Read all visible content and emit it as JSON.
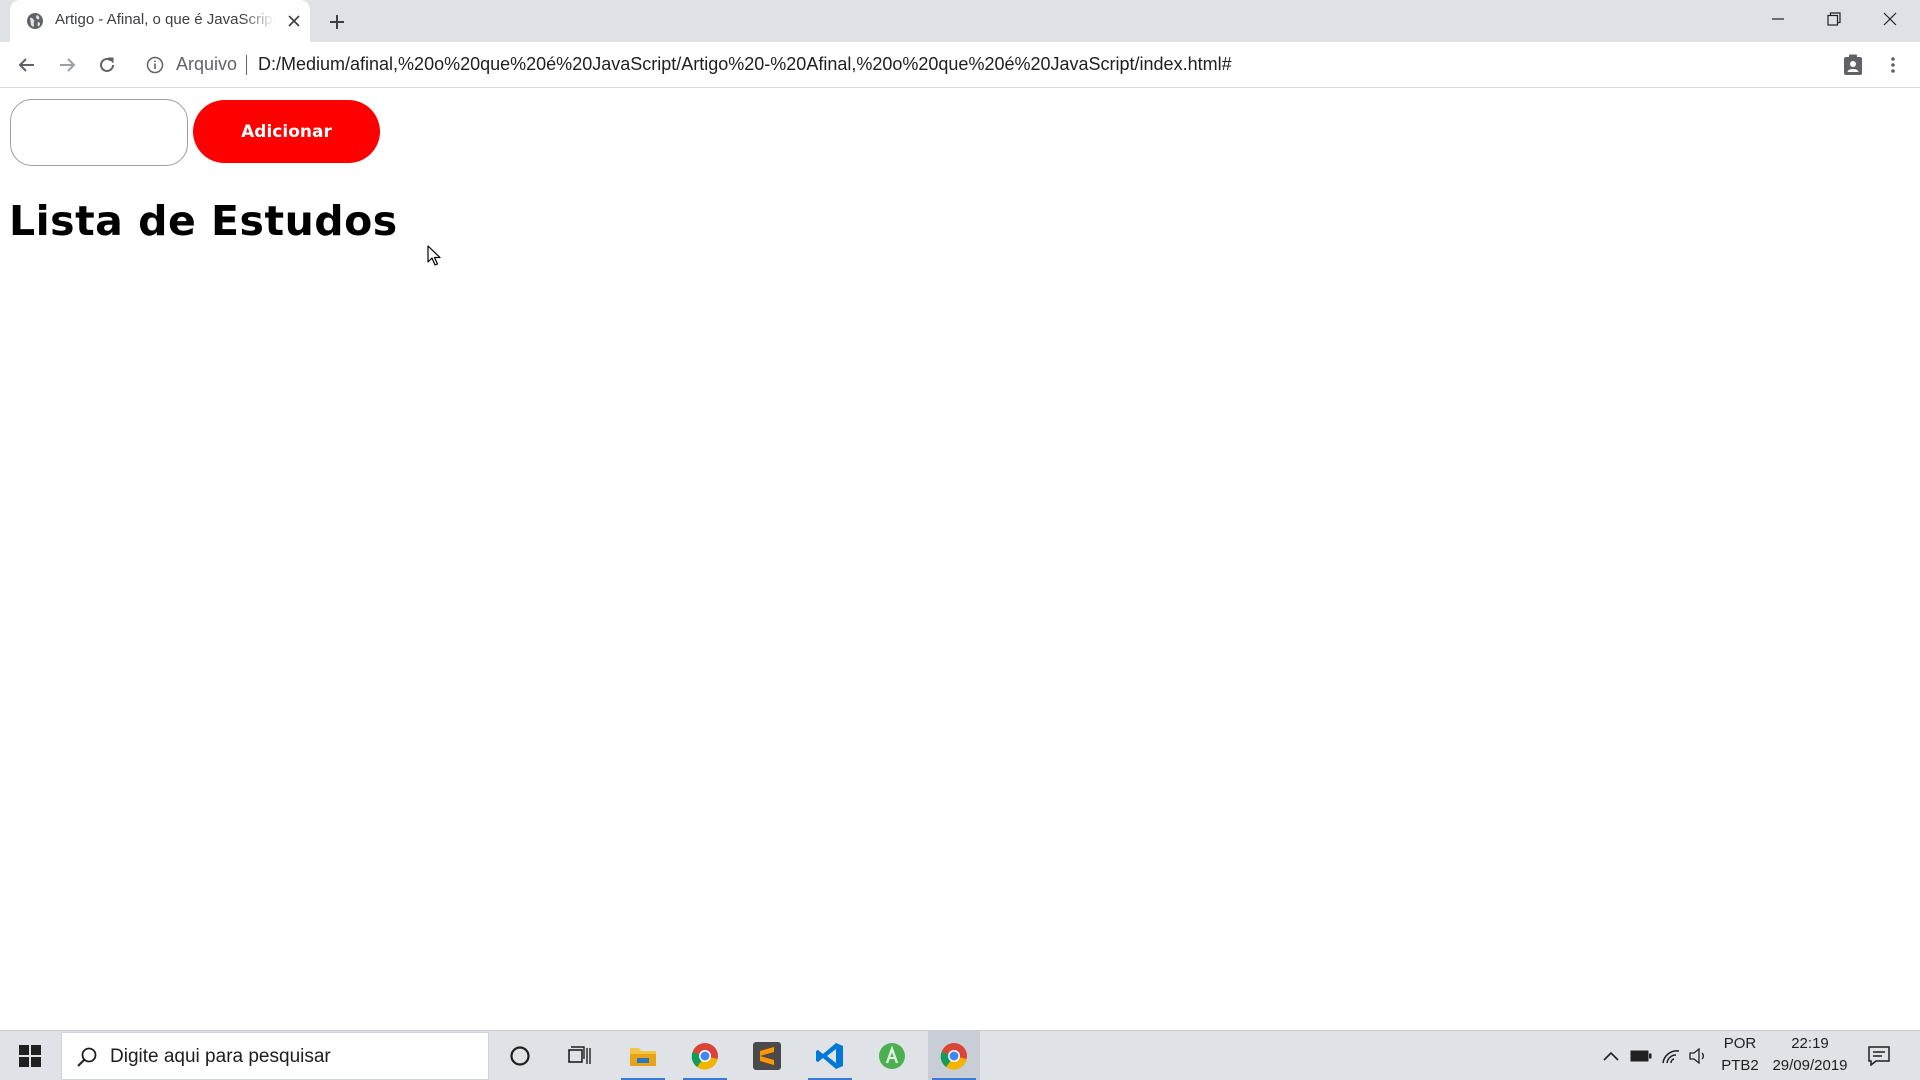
{
  "browser": {
    "tab_title": "Artigo - Afinal, o que é JavaScript",
    "address_prefix": "Arquivo",
    "url": "D:/Medium/afinal,%20o%20que%20é%20JavaScript/Artigo%20-%20Afinal,%20o%20que%20é%20JavaScript/index.html#"
  },
  "page": {
    "input_value": "",
    "add_button_label": "Adicionar",
    "title": "Lista de Estudos"
  },
  "taskbar": {
    "search_placeholder": "Digite aqui para pesquisar",
    "language_top": "POR",
    "language_bottom": "PTB2",
    "time": "22:19",
    "date": "29/09/2019"
  },
  "colors": {
    "accent": "#ff0000",
    "tab_strip": "#dee1e6",
    "taskbar": "#dfe3e8"
  },
  "icons": {
    "tab_favicon": "globe-icon",
    "tab_close": "close-icon",
    "new_tab": "plus-icon",
    "nav": [
      "back-arrow-icon",
      "forward-arrow-icon",
      "reload-icon"
    ],
    "address_info": "info-icon",
    "profile": "profile-icon",
    "menu": "kebab-menu-icon",
    "taskbar_apps": [
      "cortana-icon",
      "task-view-icon",
      "file-explorer-icon",
      "chrome-icon",
      "sublime-text-icon",
      "vscode-icon",
      "android-studio-icon",
      "chrome-icon"
    ]
  }
}
